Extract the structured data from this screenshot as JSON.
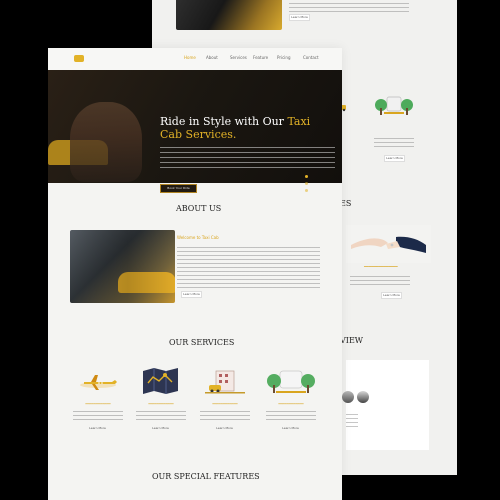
{
  "navigation": {
    "items": [
      "Home",
      "About",
      "Services",
      "Feature",
      "Pricing",
      "Contact"
    ]
  },
  "hero": {
    "title_prefix": "Ride in Style with Our ",
    "title_highlight": "Taxi Cab",
    "title_suffix": " Services.",
    "button": "Book Your Ride"
  },
  "about": {
    "title": "ABOUT US",
    "subtitle_prefix": "Welcome to ",
    "subtitle_highlight": "Taxi Cab",
    "button": "Learn More"
  },
  "services": {
    "title": "OUR SERVICES",
    "buttons": [
      "Learn More",
      "Learn More",
      "Learn More",
      "Learn More"
    ],
    "icons": [
      "airplane-icon",
      "map-icon",
      "city-icon",
      "park-icon"
    ]
  },
  "special_features": {
    "title": "OUR SPECIAL FEATURES"
  },
  "back_page": {
    "section_es": "ES",
    "section_view": "VIEW",
    "learn_more_top": "Learn More",
    "learn_more_middle": "Learn More",
    "learn_more_bottom": "Learn More"
  },
  "colors": {
    "accent": "#d9a51e",
    "dark": "#1b1711",
    "background": "#f4f4f2"
  }
}
